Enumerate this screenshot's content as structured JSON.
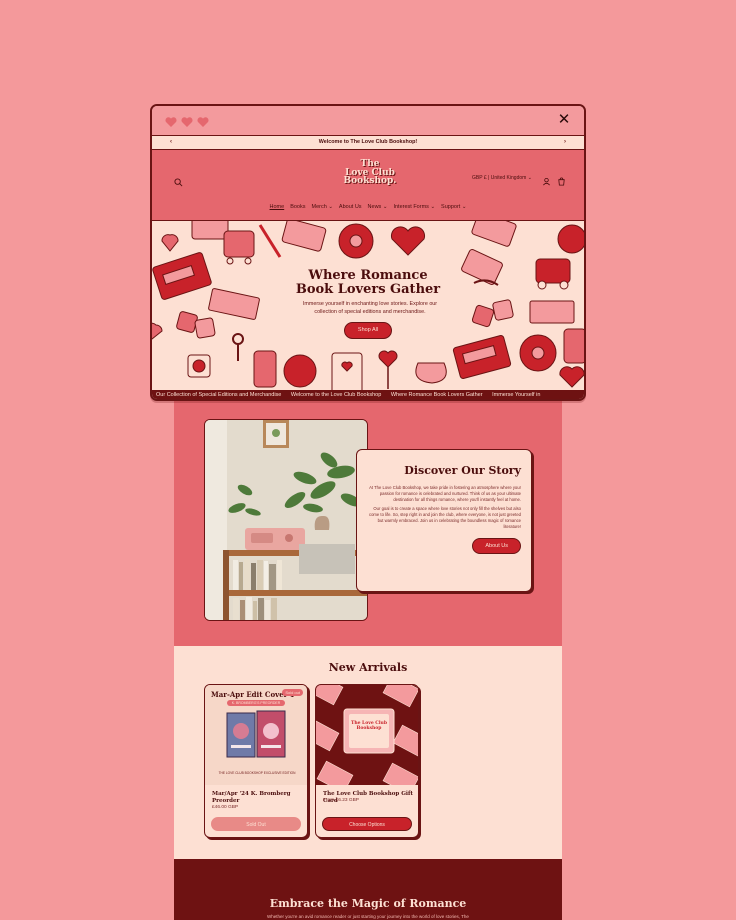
{
  "window": {
    "announcement": "Welcome to The Love Club Bookshop!",
    "logo_lines": [
      "The",
      "Love Club",
      "Bookshop."
    ],
    "currency": "GBP £ | United Kingdom",
    "nav": [
      "Home",
      "Books",
      "Merch",
      "About Us",
      "News",
      "Interest Forms",
      "Support"
    ],
    "nav_dropdown_flags": [
      false,
      false,
      true,
      false,
      true,
      true,
      true
    ],
    "hero": {
      "title_line1": "Where Romance",
      "title_line2": "Book Lovers Gather",
      "subtitle": "Immerse yourself in enchanting love stories. Explore our collection of special editions and merchandise.",
      "button": "Shop All"
    },
    "marquee": [
      "Our Collection of Special Editions and Merchandise",
      "Welcome to the Love Club Bookshop",
      "Where Romance Book Lovers Gather",
      "Immerse Yourself in"
    ]
  },
  "story": {
    "title": "Discover Our Story",
    "para1": "At The Love Club Bookshop, we take pride in fostering an atmosphere where your passion for romance is celebrated and nurtured. Think of us as your ultimate destination for all things romance, where you'll instantly feel at home.",
    "para2": "Our goal is to create a space where love stories not only fill the shelves but also come to life. So, step right in and join the club, where everyone, is not just greeted but warmly embraced. Join us in celebrating the boundless magic of romance literature!",
    "button": "About Us"
  },
  "arrivals": {
    "title": "New Arrivals",
    "products": [
      {
        "banner": "Mar-Apr Edit Cover 1",
        "badge": "Sold out",
        "strip": "K. BROMBERG'S PREORDER",
        "small_print": "THE LOVE CLUB BOOKSHOP EXCLUSIVE EDITION",
        "name": "Mar/Apr '24 K. Bromberg Preorder",
        "price": "£46.00 GBP",
        "button": "Sold Out"
      },
      {
        "card_text": "The Love Club Bookshop",
        "name": "The Love Club Bookshop Gift Card",
        "price": "From £6.23 GBP",
        "button": "Choose Options"
      }
    ]
  },
  "footer": {
    "title": "Embrace the Magic of Romance",
    "text": "Whether you're an avid romance reader or just starting your journey into the world of love stories, The"
  },
  "colors": {
    "background": "#f4999b",
    "accent_red": "#c8222a",
    "dark_maroon": "#6e1212",
    "cream": "#fde0d3",
    "header_pink": "#e5676e"
  },
  "icons": [
    "heart-icon",
    "close-icon",
    "search-icon",
    "account-icon",
    "cart-icon",
    "chevron-left-icon",
    "chevron-right-icon",
    "chevron-down-icon"
  ]
}
